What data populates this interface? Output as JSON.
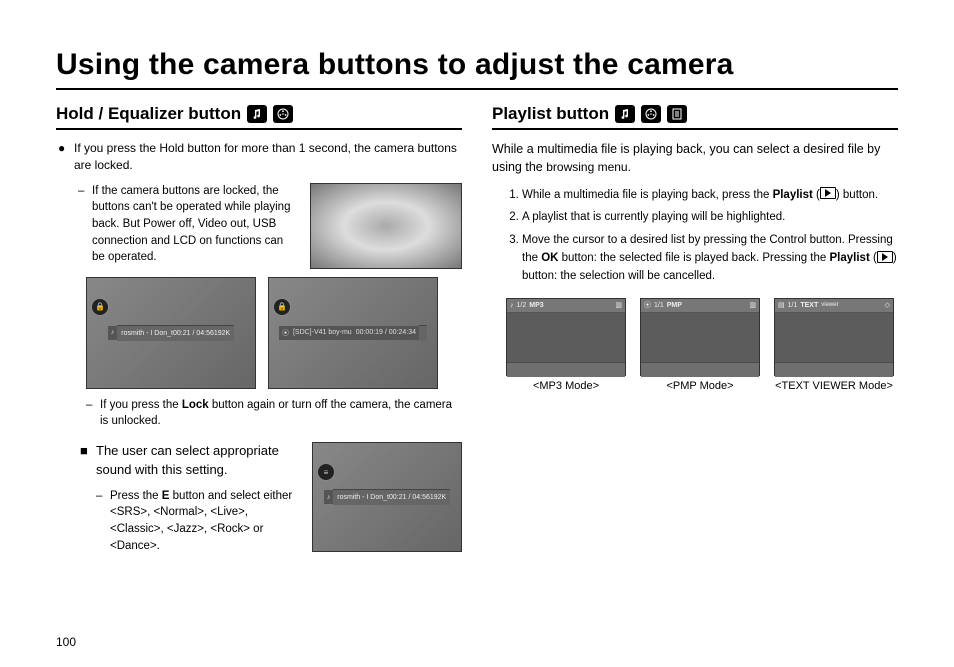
{
  "page": {
    "number": "100",
    "title": "Using the camera buttons to adjust the camera"
  },
  "left": {
    "heading": "Hold / Equalizer button",
    "bullet1": "If you press the Hold button for more than 1 second, the camera buttons are locked.",
    "sub1": "If the camera buttons are locked, the buttons can't be operated while playing back. But Power off, Video out, USB connection and LCD on functions can be operated.",
    "sub2_prefix": "If you press the ",
    "sub2_bold": "Lock",
    "sub2_suffix": " button again or turn off the camera, the camera is unlocked.",
    "bullet2": "The user can select appropriate sound with this setting.",
    "sub3_prefix": "Press the ",
    "sub3_bold": "E",
    "sub3_suffix": " button and select either <SRS>, <Normal>, <Live>, <Classic>, <Jazz>, <Rock> or <Dance>.",
    "screenshot_track": "rosmith - I Don_t",
    "screenshot_time1": "00:21 / 04:56",
    "screenshot_bitrate": "192K",
    "video_title": "[SDC]-V41 boy-mu",
    "video_time": "00:00:19 / 00:24:34"
  },
  "right": {
    "heading": "Playlist button",
    "intro_a": "While a multimedia file is playing back, you can select a desired file by using the ",
    "intro_b": "browsing menu.",
    "step1_a": "While a multimedia file is playing back, press the ",
    "step1_bold": "Playlist",
    "step1_b": " (",
    "step1_c": ") button.",
    "step2": "A playlist that is currently playing will be highlighted.",
    "step3_a": "Move the cursor to a desired list by pressing the Control button. Pressing the ",
    "step3_bold1": "OK",
    "step3_b": " button: the selected file is played back. Pressing the ",
    "step3_bold2": "Playlist",
    "step3_c": " (",
    "step3_d": ") button: the selection will be cancelled.",
    "modes": {
      "mp3": {
        "tag": "1/2",
        "name": "MP3",
        "label": "<MP3 Mode>"
      },
      "pmp": {
        "tag": "1/1",
        "name": "PMP",
        "label": "<PMP Mode>"
      },
      "text": {
        "tag": "1/1",
        "name": "TEXT",
        "sub": "viewer",
        "label": "<TEXT VIEWER Mode>"
      }
    }
  }
}
